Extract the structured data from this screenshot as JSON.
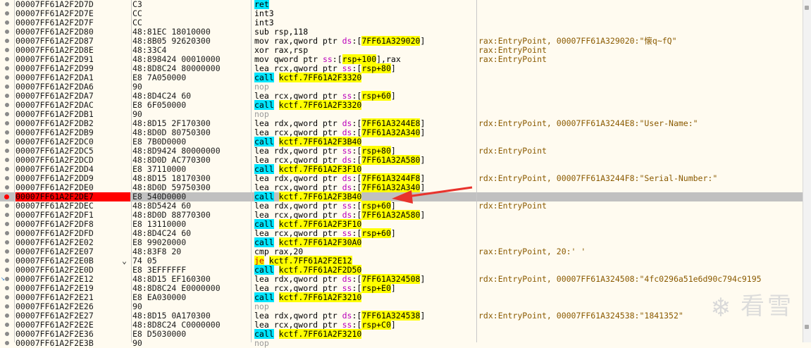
{
  "colors": {
    "breakpoint": "#ff0000",
    "call_highlight": "#00e5ff",
    "jump_highlight": "#ffff00",
    "selected_row": "#c0c0c0",
    "annotation_arrow": "#e8332d"
  },
  "rows": [
    {
      "addr": "00007FF61A2F2D7D",
      "bytes": "C3",
      "parts": [
        {
          "t": "ret",
          "c": "ret"
        }
      ],
      "comment": ""
    },
    {
      "addr": "00007FF61A2F2D7E",
      "bytes": "CC",
      "parts": [
        {
          "t": "int3"
        }
      ],
      "comment": ""
    },
    {
      "addr": "00007FF61A2F2D7F",
      "bytes": "CC",
      "parts": [
        {
          "t": "int3"
        }
      ],
      "comment": ""
    },
    {
      "addr": "00007FF61A2F2D80",
      "bytes": "48:81EC 18010000",
      "parts": [
        {
          "t": "sub rsp,118"
        }
      ],
      "comment": ""
    },
    {
      "addr": "00007FF61A2F2D87",
      "bytes": "48:8B05 92620300",
      "parts": [
        {
          "t": "mov rax,qword ptr "
        },
        {
          "t": "ds",
          "c": "seg"
        },
        {
          "t": ":["
        },
        {
          "t": "7FF61A329020",
          "c": "mem"
        },
        {
          "t": "]"
        }
      ],
      "comment": "rax:EntryPoint, 00007FF61A329020:\"懐q~fQ\""
    },
    {
      "addr": "00007FF61A2F2D8E",
      "bytes": "48:33C4",
      "parts": [
        {
          "t": "xor rax,rsp"
        }
      ],
      "comment": "rax:EntryPoint"
    },
    {
      "addr": "00007FF61A2F2D91",
      "bytes": "48:898424 00010000",
      "parts": [
        {
          "t": "mov qword ptr "
        },
        {
          "t": "ss",
          "c": "seg"
        },
        {
          "t": ":["
        },
        {
          "t": "rsp+100",
          "c": "mem"
        },
        {
          "t": "],rax"
        }
      ],
      "comment": "rax:EntryPoint"
    },
    {
      "addr": "00007FF61A2F2D99",
      "bytes": "48:8D8C24 80000000",
      "parts": [
        {
          "t": "lea rcx,qword ptr "
        },
        {
          "t": "ss",
          "c": "seg"
        },
        {
          "t": ":["
        },
        {
          "t": "rsp+80",
          "c": "mem"
        },
        {
          "t": "]"
        }
      ],
      "comment": ""
    },
    {
      "addr": "00007FF61A2F2DA1",
      "bytes": "E8 7A050000",
      "parts": [
        {
          "t": "call",
          "c": "call"
        },
        {
          "t": " "
        },
        {
          "t": "kctf.7FF61A2F3320",
          "c": "tgt"
        }
      ],
      "comment": ""
    },
    {
      "addr": "00007FF61A2F2DA6",
      "bytes": "90",
      "parts": [
        {
          "t": "nop",
          "c": "nop"
        }
      ],
      "comment": ""
    },
    {
      "addr": "00007FF61A2F2DA7",
      "bytes": "48:8D4C24 60",
      "parts": [
        {
          "t": "lea rcx,qword ptr "
        },
        {
          "t": "ss",
          "c": "seg"
        },
        {
          "t": ":["
        },
        {
          "t": "rsp+60",
          "c": "mem"
        },
        {
          "t": "]"
        }
      ],
      "comment": ""
    },
    {
      "addr": "00007FF61A2F2DAC",
      "bytes": "E8 6F050000",
      "parts": [
        {
          "t": "call",
          "c": "call"
        },
        {
          "t": " "
        },
        {
          "t": "kctf.7FF61A2F3320",
          "c": "tgt"
        }
      ],
      "comment": ""
    },
    {
      "addr": "00007FF61A2F2DB1",
      "bytes": "90",
      "parts": [
        {
          "t": "nop",
          "c": "nop"
        }
      ],
      "comment": ""
    },
    {
      "addr": "00007FF61A2F2DB2",
      "bytes": "48:8D15 2F170300",
      "parts": [
        {
          "t": "lea rdx,qword ptr "
        },
        {
          "t": "ds",
          "c": "seg"
        },
        {
          "t": ":["
        },
        {
          "t": "7FF61A3244E8",
          "c": "mem"
        },
        {
          "t": "]"
        }
      ],
      "comment": "rdx:EntryPoint, 00007FF61A3244E8:\"User-Name:\""
    },
    {
      "addr": "00007FF61A2F2DB9",
      "bytes": "48:8D0D 80750300",
      "parts": [
        {
          "t": "lea rcx,qword ptr "
        },
        {
          "t": "ds",
          "c": "seg"
        },
        {
          "t": ":["
        },
        {
          "t": "7FF61A32A340",
          "c": "mem"
        },
        {
          "t": "]"
        }
      ],
      "comment": ""
    },
    {
      "addr": "00007FF61A2F2DC0",
      "bytes": "E8 7B0D0000",
      "parts": [
        {
          "t": "call",
          "c": "call"
        },
        {
          "t": " "
        },
        {
          "t": "kctf.7FF61A2F3B40",
          "c": "tgt"
        }
      ],
      "comment": ""
    },
    {
      "addr": "00007FF61A2F2DC5",
      "bytes": "48:8D9424 80000000",
      "parts": [
        {
          "t": "lea rdx,qword ptr "
        },
        {
          "t": "ss",
          "c": "seg"
        },
        {
          "t": ":["
        },
        {
          "t": "rsp+80",
          "c": "mem"
        },
        {
          "t": "]"
        }
      ],
      "comment": "rdx:EntryPoint"
    },
    {
      "addr": "00007FF61A2F2DCD",
      "bytes": "48:8D0D AC770300",
      "parts": [
        {
          "t": "lea rcx,qword ptr "
        },
        {
          "t": "ds",
          "c": "seg"
        },
        {
          "t": ":["
        },
        {
          "t": "7FF61A32A580",
          "c": "mem"
        },
        {
          "t": "]"
        }
      ],
      "comment": ""
    },
    {
      "addr": "00007FF61A2F2DD4",
      "bytes": "E8 37110000",
      "parts": [
        {
          "t": "call",
          "c": "call"
        },
        {
          "t": " "
        },
        {
          "t": "kctf.7FF61A2F3F10",
          "c": "tgt"
        }
      ],
      "comment": ""
    },
    {
      "addr": "00007FF61A2F2DD9",
      "bytes": "48:8D15 18170300",
      "parts": [
        {
          "t": "lea rdx,qword ptr "
        },
        {
          "t": "ds",
          "c": "seg"
        },
        {
          "t": ":["
        },
        {
          "t": "7FF61A3244F8",
          "c": "mem"
        },
        {
          "t": "]"
        }
      ],
      "comment": "rdx:EntryPoint, 00007FF61A3244F8:\"Serial-Number:\""
    },
    {
      "addr": "00007FF61A2F2DE0",
      "bytes": "48:8D0D 59750300",
      "parts": [
        {
          "t": "lea rcx,qword ptr "
        },
        {
          "t": "ds",
          "c": "seg"
        },
        {
          "t": ":["
        },
        {
          "t": "7FF61A32A340",
          "c": "mem"
        },
        {
          "t": "]"
        }
      ],
      "comment": ""
    },
    {
      "addr": "00007FF61A2F2DE7",
      "bytes": "E8 540D0000",
      "parts": [
        {
          "t": "call",
          "c": "call"
        },
        {
          "t": " "
        },
        {
          "t": "kctf.7FF61A2F3B40",
          "c": "tgt"
        }
      ],
      "comment": "",
      "breakpoint": true,
      "selected": true
    },
    {
      "addr": "00007FF61A2F2DEC",
      "bytes": "48:8D5424 60",
      "parts": [
        {
          "t": "lea rdx,qword ptr "
        },
        {
          "t": "ss",
          "c": "seg"
        },
        {
          "t": ":["
        },
        {
          "t": "rsp+60",
          "c": "mem"
        },
        {
          "t": "]"
        }
      ],
      "comment": "rdx:EntryPoint"
    },
    {
      "addr": "00007FF61A2F2DF1",
      "bytes": "48:8D0D 88770300",
      "parts": [
        {
          "t": "lea rcx,qword ptr "
        },
        {
          "t": "ds",
          "c": "seg"
        },
        {
          "t": ":["
        },
        {
          "t": "7FF61A32A580",
          "c": "mem"
        },
        {
          "t": "]"
        }
      ],
      "comment": ""
    },
    {
      "addr": "00007FF61A2F2DF8",
      "bytes": "E8 13110000",
      "parts": [
        {
          "t": "call",
          "c": "call"
        },
        {
          "t": " "
        },
        {
          "t": "kctf.7FF61A2F3F10",
          "c": "tgt"
        }
      ],
      "comment": ""
    },
    {
      "addr": "00007FF61A2F2DFD",
      "bytes": "48:8D4C24 60",
      "parts": [
        {
          "t": "lea rcx,qword ptr "
        },
        {
          "t": "ss",
          "c": "seg"
        },
        {
          "t": ":["
        },
        {
          "t": "rsp+60",
          "c": "mem"
        },
        {
          "t": "]"
        }
      ],
      "comment": ""
    },
    {
      "addr": "00007FF61A2F2E02",
      "bytes": "E8 99020000",
      "parts": [
        {
          "t": "call",
          "c": "call"
        },
        {
          "t": " "
        },
        {
          "t": "kctf.7FF61A2F30A0",
          "c": "tgt"
        }
      ],
      "comment": ""
    },
    {
      "addr": "00007FF61A2F2E07",
      "bytes": "48:83F8 20",
      "parts": [
        {
          "t": "cmp rax,20"
        }
      ],
      "comment": "rax:EntryPoint, 20:' '"
    },
    {
      "addr": "00007FF61A2F2E0B",
      "bytes": "74 05",
      "parts": [
        {
          "t": "je",
          "c": "jcc"
        },
        {
          "t": " "
        },
        {
          "t": "kctf.7FF61A2F2E12",
          "c": "tgt"
        }
      ],
      "comment": "",
      "jump": true
    },
    {
      "addr": "00007FF61A2F2E0D",
      "bytes": "E8 3EFFFFFF",
      "parts": [
        {
          "t": "call",
          "c": "call"
        },
        {
          "t": " "
        },
        {
          "t": "kctf.7FF61A2F2D50",
          "c": "tgt"
        }
      ],
      "comment": ""
    },
    {
      "addr": "00007FF61A2F2E12",
      "bytes": "48:8D15 EF160300",
      "parts": [
        {
          "t": "lea rdx,qword ptr "
        },
        {
          "t": "ds",
          "c": "seg"
        },
        {
          "t": ":["
        },
        {
          "t": "7FF61A324508",
          "c": "mem"
        },
        {
          "t": "]"
        }
      ],
      "comment": "rdx:EntryPoint, 00007FF61A324508:\"4fc0296a51e6d90c794c9195",
      "jumpdest": true
    },
    {
      "addr": "00007FF61A2F2E19",
      "bytes": "48:8D8C24 E0000000",
      "parts": [
        {
          "t": "lea rcx,qword ptr "
        },
        {
          "t": "ss",
          "c": "seg"
        },
        {
          "t": ":["
        },
        {
          "t": "rsp+E0",
          "c": "mem"
        },
        {
          "t": "]"
        }
      ],
      "comment": ""
    },
    {
      "addr": "00007FF61A2F2E21",
      "bytes": "E8 EA030000",
      "parts": [
        {
          "t": "call",
          "c": "call"
        },
        {
          "t": " "
        },
        {
          "t": "kctf.7FF61A2F3210",
          "c": "tgt"
        }
      ],
      "comment": ""
    },
    {
      "addr": "00007FF61A2F2E26",
      "bytes": "90",
      "parts": [
        {
          "t": "nop",
          "c": "nop"
        }
      ],
      "comment": ""
    },
    {
      "addr": "00007FF61A2F2E27",
      "bytes": "48:8D15 0A170300",
      "parts": [
        {
          "t": "lea rdx,qword ptr "
        },
        {
          "t": "ds",
          "c": "seg"
        },
        {
          "t": ":["
        },
        {
          "t": "7FF61A324538",
          "c": "mem"
        },
        {
          "t": "]"
        }
      ],
      "comment": "rdx:EntryPoint, 00007FF61A324538:\"1841352\""
    },
    {
      "addr": "00007FF61A2F2E2E",
      "bytes": "48:8D8C24 C0000000",
      "parts": [
        {
          "t": "lea rcx,qword ptr "
        },
        {
          "t": "ss",
          "c": "seg"
        },
        {
          "t": ":["
        },
        {
          "t": "rsp+C0",
          "c": "mem"
        },
        {
          "t": "]"
        }
      ],
      "comment": ""
    },
    {
      "addr": "00007FF61A2F2E36",
      "bytes": "E8 D5030000",
      "parts": [
        {
          "t": "call",
          "c": "call"
        },
        {
          "t": " "
        },
        {
          "t": "kctf.7FF61A2F3210",
          "c": "tgt"
        }
      ],
      "comment": ""
    },
    {
      "addr": "00007FF61A2F2E3B",
      "bytes": "90",
      "parts": [
        {
          "t": "nop",
          "c": "nop"
        }
      ],
      "comment": ""
    }
  ],
  "watermark": {
    "text": "看雪",
    "icon": "snowflake-icon"
  }
}
